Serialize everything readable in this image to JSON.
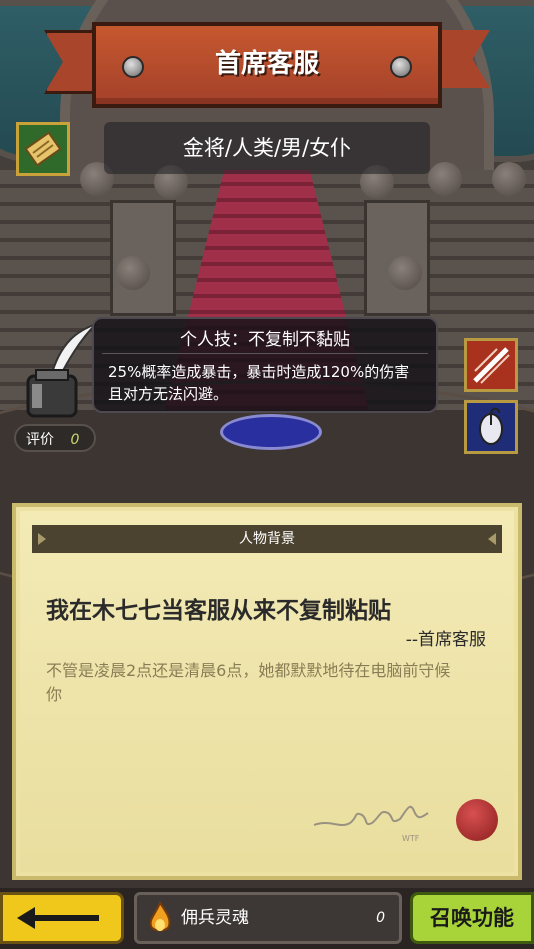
{
  "header": {
    "title": "首席客服",
    "subtitle": "金将/人类/男/女仆"
  },
  "skill": {
    "title": "个人技：不复制不黏贴",
    "description": "25%概率造成暴击，暴击时造成120%的伤害且对方无法闪避。"
  },
  "rating": {
    "label": "评价",
    "value": "0"
  },
  "background_card": {
    "header": "人物背景",
    "quote": "我在木七七当客服从来不复制粘贴",
    "author": "--首席客服",
    "story": "不管是凌晨2点还是清晨6点，她都默默地待在电脑前守候你"
  },
  "bottom_bar": {
    "soul_label": "佣兵灵魂",
    "soul_value": "0",
    "summon_label": "召唤功能"
  },
  "icons": [
    "scroll-icon",
    "ink-quill-icon",
    "sword-slash-icon",
    "mouse-icon",
    "back-arrow-icon",
    "flame-soul-icon",
    "wax-seal-icon"
  ],
  "colors": {
    "banner": "#a8412a",
    "card": "#ede2a4",
    "back_button": "#f0c81c",
    "summon_button": "#a8d43a"
  }
}
